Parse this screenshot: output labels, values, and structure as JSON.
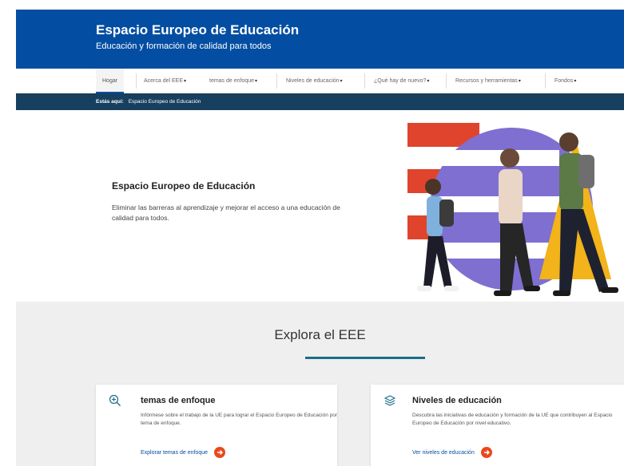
{
  "header": {
    "title": "Espacio Europeo de Educación",
    "subtitle": "Educación y formación de calidad para todos"
  },
  "nav": {
    "items": [
      {
        "label": "Hogar",
        "caret": ""
      },
      {
        "label": "Acerca del EEE",
        "caret": "▾"
      },
      {
        "label": "temas de enfoque",
        "caret": "▾"
      },
      {
        "label": "Niveles de educación",
        "caret": "▾"
      },
      {
        "label": "¿Qué hay de nuevo?",
        "caret": "▾"
      },
      {
        "label": "Recursos y herramientas",
        "caret": "▾"
      },
      {
        "label": "Fondos",
        "caret": "▾"
      }
    ]
  },
  "breadcrumb": {
    "prefix": "Estás aquí:",
    "current": "Espacio Europeo de Educación"
  },
  "hero": {
    "title": "Espacio Europeo de Educación",
    "text": "Eliminar las barreras al aprendizaje y mejorar el acceso a una educación de calidad para todos."
  },
  "explore": {
    "heading": "Explora el EEE"
  },
  "cards": [
    {
      "icon": "zoom-in-icon",
      "title": "temas de enfoque",
      "description": "Infórmese sobre el trabajo de la UE para lograr el Espacio Europeo de Educación por tema de enfoque.",
      "link": "Explorar temas de enfoque"
    },
    {
      "icon": "layers-icon",
      "title": "Niveles de educación",
      "description": "Descubra las iniciativas de educación y formación de la UE que contribuyen al Espacio Europeo de Educación por nivel educativo.",
      "link": "Ver niveles de educación"
    }
  ],
  "colors": {
    "brand_blue": "#034ea2",
    "breadcrumb_bg": "#173f5f",
    "accent_orange": "#e8491d",
    "art_red": "#e0442d",
    "art_purple": "#7f6fd1",
    "art_yellow": "#f2b31b",
    "underline_teal": "#1a6e86"
  }
}
